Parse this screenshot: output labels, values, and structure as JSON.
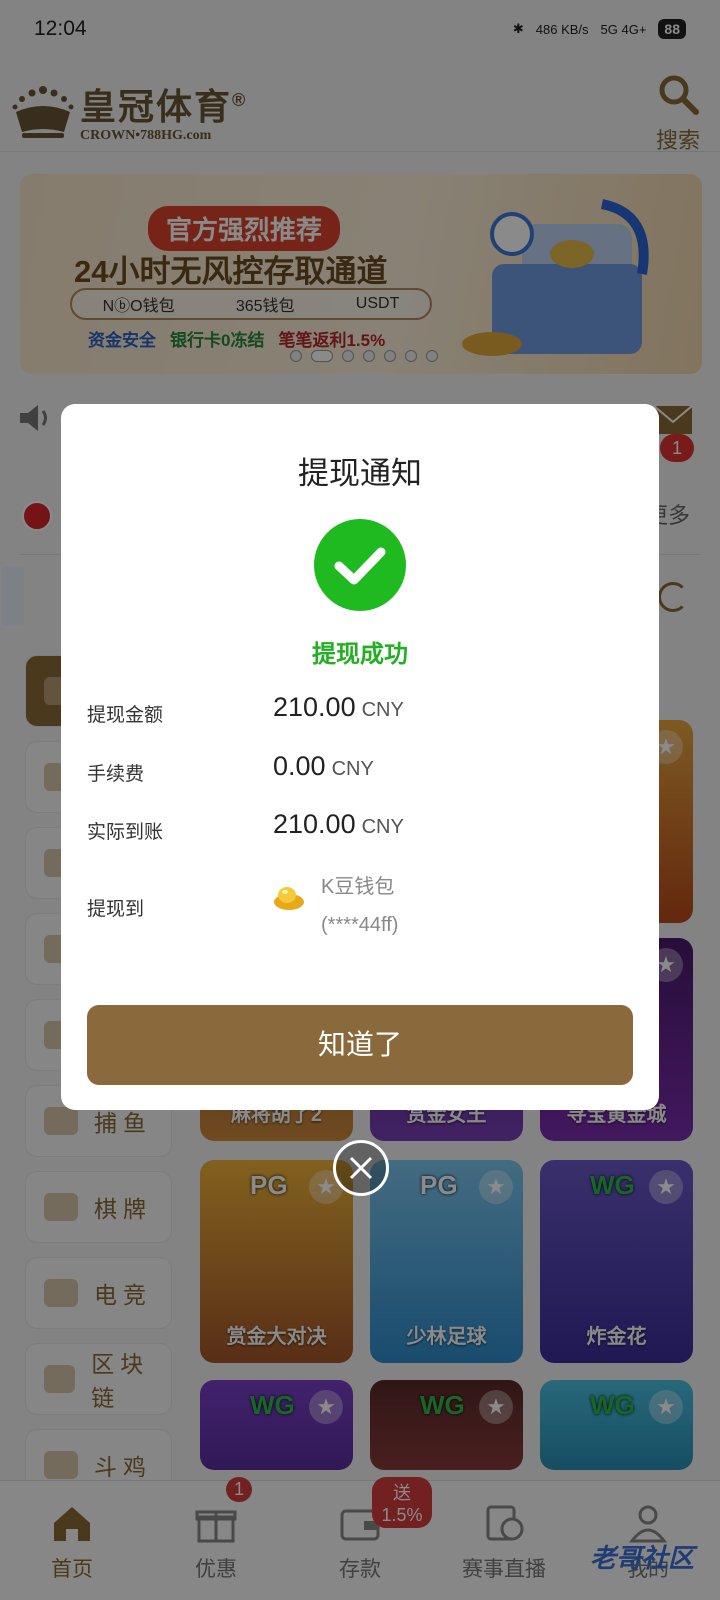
{
  "status_bar": {
    "time": "12:04",
    "speed": "486 KB/s",
    "network": "5G 4G+",
    "battery": "88"
  },
  "header": {
    "logo_title": "皇冠体育",
    "logo_reg": "®",
    "logo_sub": "CROWN•788HG.com",
    "search_label": "搜索"
  },
  "banner": {
    "tag": "官方强烈推荐",
    "title": "24小时无风控存取通道",
    "wallets": [
      "NⓑO钱包",
      "365钱包",
      "USDT"
    ],
    "line_a": "资金安全",
    "line_b": "银行卡0冻结",
    "line_c": "笔笔返利1.5%"
  },
  "background": {
    "mail_badge": "1",
    "more": "更多",
    "categories": [
      "",
      "",
      "",
      "",
      "",
      "捕鱼",
      "棋牌",
      "电竞",
      "区块链",
      "斗鸡"
    ],
    "tiles": [
      {
        "name": "麻将胡了2",
        "logo": ""
      },
      {
        "name": "赏金女王",
        "logo": ""
      },
      {
        "name": "寻宝黄金城",
        "logo": ""
      },
      {
        "name": "赏金大对决",
        "logo": "PG"
      },
      {
        "name": "少林足球",
        "logo": "PG"
      },
      {
        "name": "炸金花",
        "logo": "WG"
      },
      {
        "name": "",
        "logo": "WG"
      },
      {
        "name": "",
        "logo": "WG"
      },
      {
        "name": "",
        "logo": "WG"
      }
    ]
  },
  "bottom_nav": {
    "items": [
      {
        "label": "首页"
      },
      {
        "label": "优惠",
        "badge": "1"
      },
      {
        "label": "存款",
        "badge": "送1.5%"
      },
      {
        "label": "赛事直播"
      },
      {
        "label": "我的"
      }
    ],
    "watermark": "老哥社区"
  },
  "dialog": {
    "title": "提现通知",
    "status": "提现成功",
    "rows": [
      {
        "label": "提现金额",
        "value": "210.00",
        "unit": "CNY"
      },
      {
        "label": "手续费",
        "value": "0.00",
        "unit": "CNY"
      },
      {
        "label": "实际到账",
        "value": "210.00",
        "unit": "CNY"
      }
    ],
    "destination_label": "提现到",
    "wallet_name": "K豆钱包",
    "wallet_account": "(****44ff)",
    "button": "知道了"
  },
  "colors": {
    "brand": "#8a6a3c",
    "success": "#22b022",
    "badge": "#d43b3b"
  }
}
